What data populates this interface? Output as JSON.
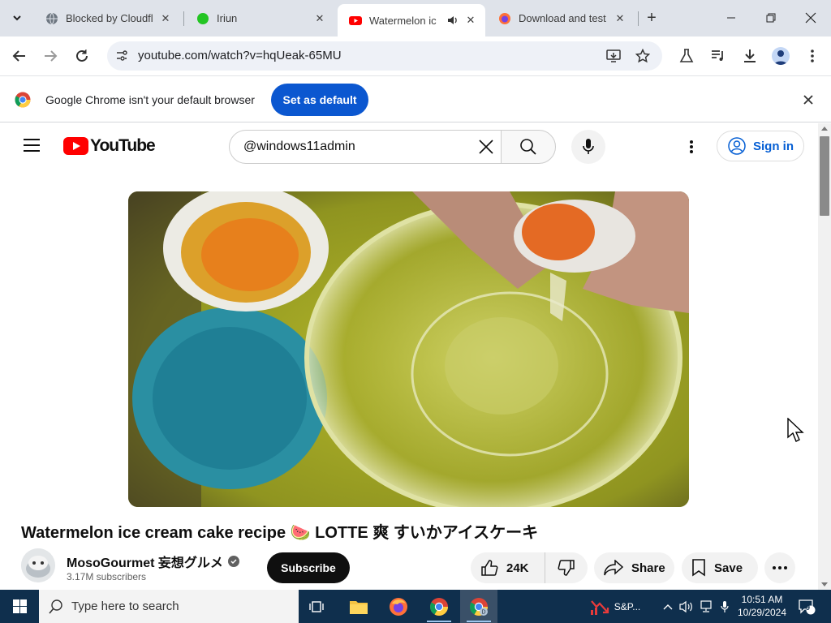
{
  "browser": {
    "tabs": [
      {
        "title": "Blocked by Cloudfl",
        "favicon": "globe-icon",
        "active": false
      },
      {
        "title": "Iriun",
        "favicon": "green-dot-icon",
        "active": false
      },
      {
        "title": "Watermelon ic",
        "favicon": "youtube-icon",
        "active": true,
        "audio": true
      },
      {
        "title": "Download and test",
        "favicon": "firefox-icon",
        "active": false
      }
    ],
    "url": "youtube.com/watch?v=hqUeak-65MU",
    "infobar": {
      "message": "Google Chrome isn't your default browser",
      "button": "Set as default"
    }
  },
  "youtube": {
    "logo_text": "YouTube",
    "search_query": "@windows11admin",
    "sign_in": "Sign in",
    "video": {
      "title": "Watermelon ice cream cake recipe 🍉 LOTTE 爽 すいかアイスケーキ",
      "channel": "MosoGourmet 妄想グルメ",
      "subscribers": "3.17M subscribers",
      "subscribe_label": "Subscribe",
      "likes": "24K",
      "share_label": "Share",
      "save_label": "Save"
    }
  },
  "taskbar": {
    "search_placeholder": "Type here to search",
    "stock_label": "S&P...",
    "time": "10:51 AM",
    "date": "10/29/2024",
    "notification_count": "9"
  },
  "colors": {
    "youtube_red": "#ff0000",
    "chrome_blue": "#0b57d0",
    "link_blue": "#065fd4",
    "taskbar": "#0f2f4d"
  }
}
